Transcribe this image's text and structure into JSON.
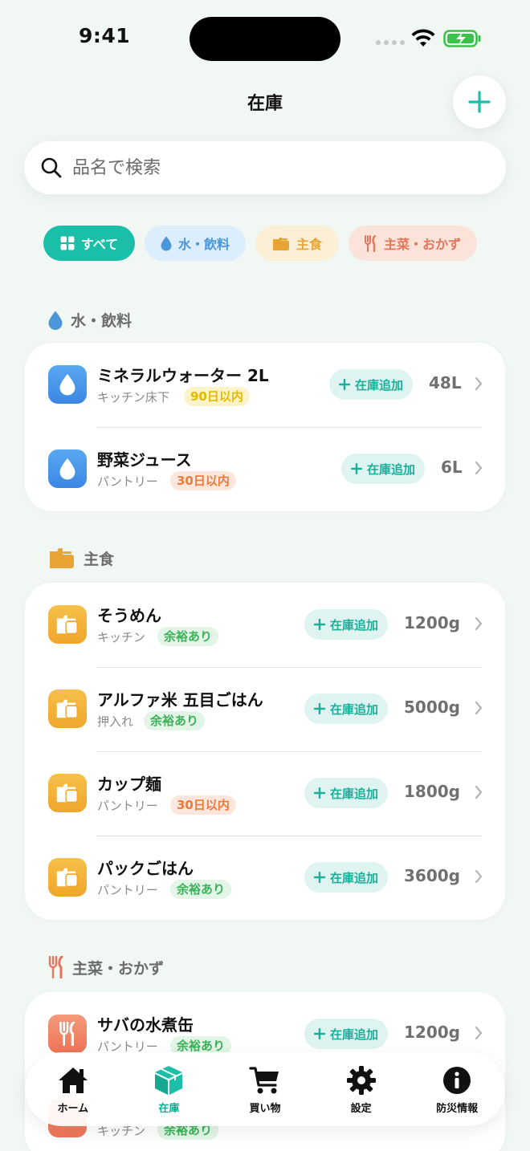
{
  "status": {
    "time": "9:41"
  },
  "header": {
    "title": "在庫",
    "add_label": "+"
  },
  "search": {
    "placeholder": "品名で検索"
  },
  "filters": [
    {
      "label": "すべて",
      "icon": "grid-icon",
      "color": "#1BBFA8",
      "active": true
    },
    {
      "label": "水・飲料",
      "icon": "water-drop-icon",
      "color": "#4A96D9",
      "active": false
    },
    {
      "label": "主食",
      "icon": "food-box-icon",
      "color": "#E9A436",
      "active": false
    },
    {
      "label": "主菜・おかず",
      "icon": "fork-knife-icon",
      "color": "#E8745A",
      "active": false
    }
  ],
  "stock_button_label": "在庫追加",
  "sections": [
    {
      "title": "水・飲料",
      "items": [
        {
          "name": "ミネラルウォーター 2L",
          "location": "キッチン床下",
          "badge": "90日以内",
          "badge_tone": "yellow",
          "quantity": "48L"
        },
        {
          "name": "野菜ジュース",
          "location": "パントリー",
          "badge": "30日以内",
          "badge_tone": "orange",
          "quantity": "6L"
        }
      ]
    },
    {
      "title": "主食",
      "items": [
        {
          "name": "そうめん",
          "location": "キッチン",
          "badge": "余裕あり",
          "badge_tone": "green",
          "quantity": "1200g"
        },
        {
          "name": "アルファ米 五目ごはん",
          "location": "押入れ",
          "badge": "余裕あり",
          "badge_tone": "green",
          "quantity": "5000g"
        },
        {
          "name": "カップ麺",
          "location": "パントリー",
          "badge": "30日以内",
          "badge_tone": "orange",
          "quantity": "1800g"
        },
        {
          "name": "パックごはん",
          "location": "パントリー",
          "badge": "余裕あり",
          "badge_tone": "green",
          "quantity": "3600g"
        }
      ]
    },
    {
      "title": "主菜・おかず",
      "items": [
        {
          "name": "サバの水煮缶",
          "location": "パントリー",
          "badge": "余裕あり",
          "badge_tone": "green",
          "quantity": "1200g"
        },
        {
          "name": "",
          "location": "キッチン",
          "badge": "余裕あり",
          "badge_tone": "green",
          "quantity": ""
        }
      ]
    }
  ],
  "tabs": [
    {
      "label": "ホーム",
      "icon": "home-icon",
      "active": false
    },
    {
      "label": "在庫",
      "icon": "box-icon",
      "active": true
    },
    {
      "label": "買い物",
      "icon": "cart-icon",
      "active": false
    },
    {
      "label": "設定",
      "icon": "gear-icon",
      "active": false
    },
    {
      "label": "防災情報",
      "icon": "info-icon",
      "active": false
    }
  ]
}
